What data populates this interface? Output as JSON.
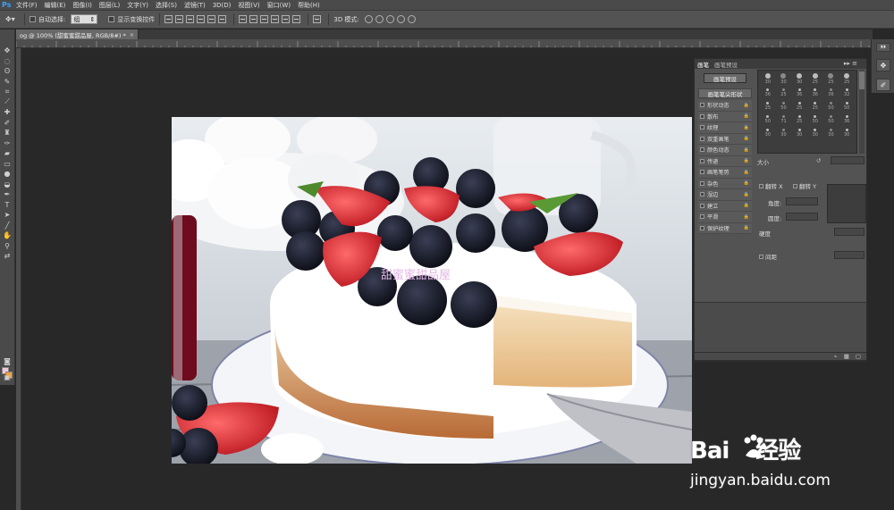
{
  "app": {
    "logo": "Ps"
  },
  "menubar": {
    "items": [
      "文件(F)",
      "编辑(E)",
      "图像(I)",
      "图层(L)",
      "文字(Y)",
      "选择(S)",
      "滤镜(T)",
      "3D(D)",
      "视图(V)",
      "窗口(W)",
      "帮助(H)"
    ]
  },
  "options": {
    "auto_select_label": "自动选择:",
    "auto_select_value": "组",
    "show_transform_label": "显示变换控件",
    "mode_3d_label": "3D 模式:"
  },
  "document": {
    "tab_title": "og @ 100% (甜蜜蜜甜品屋, RGB/8#) *",
    "canvas_text": "甜蜜蜜甜品屋"
  },
  "brush_panel": {
    "tabs": [
      "画笔",
      "画笔预设"
    ],
    "preset_button": "画笔预设",
    "tip_shape_header": "画笔笔尖形状",
    "options": [
      "形状动态",
      "散布",
      "纹理",
      "双重画笔",
      "颜色动态",
      "传递",
      "画笔笔势",
      "杂色",
      "湿边",
      "建立",
      "平滑",
      "保护纹理"
    ],
    "tip_sizes": [
      "30",
      "30",
      "30",
      "25",
      "25",
      "25",
      "36",
      "25",
      "36",
      "36",
      "36",
      "32",
      "25",
      "50",
      "25",
      "25",
      "50",
      "50",
      "50",
      "71",
      "25",
      "50",
      "50",
      "36",
      "30",
      "30",
      "30",
      "30",
      "30",
      "30"
    ],
    "size_label": "大小",
    "flip_x_label": "翻转 X",
    "flip_y_label": "翻转 Y",
    "angle_label": "角度:",
    "roundness_label": "圆度:",
    "hardness_label": "硬度",
    "spacing_label": "间距"
  },
  "watermark": {
    "brand": "Bai",
    "brand_suffix": "经验",
    "url": "jingyan.baidu.com"
  },
  "colors": {
    "foreground": "#f3c9d9",
    "background": "#f0a040",
    "accent": "#3aa0ff"
  }
}
